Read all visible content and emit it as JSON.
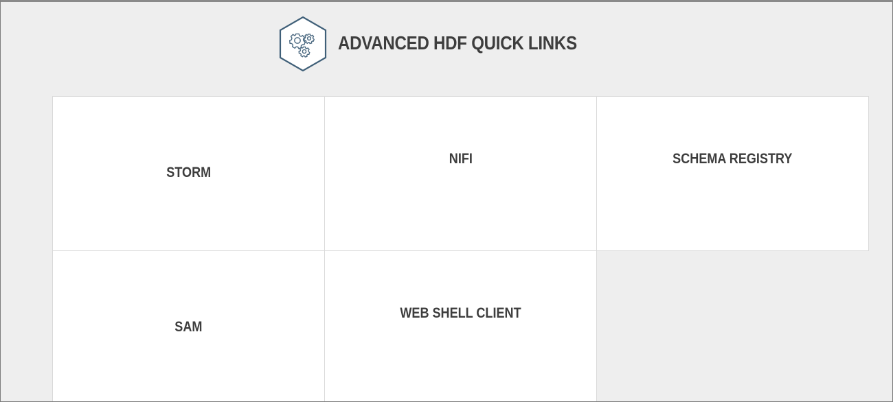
{
  "page": {
    "title": "ADVANCED HDF QUICK LINKS",
    "icon": "settings-gears-hexagon-icon",
    "colors": {
      "background": "#eeeeee",
      "tile_background": "#ffffff",
      "text": "#3d3d3d",
      "icon_stroke": "#3f5f78"
    }
  },
  "links": [
    {
      "label": "STORM"
    },
    {
      "label": "NIFI"
    },
    {
      "label": "SCHEMA REGISTRY"
    },
    {
      "label": "SAM"
    },
    {
      "label": "WEB SHELL CLIENT"
    }
  ]
}
